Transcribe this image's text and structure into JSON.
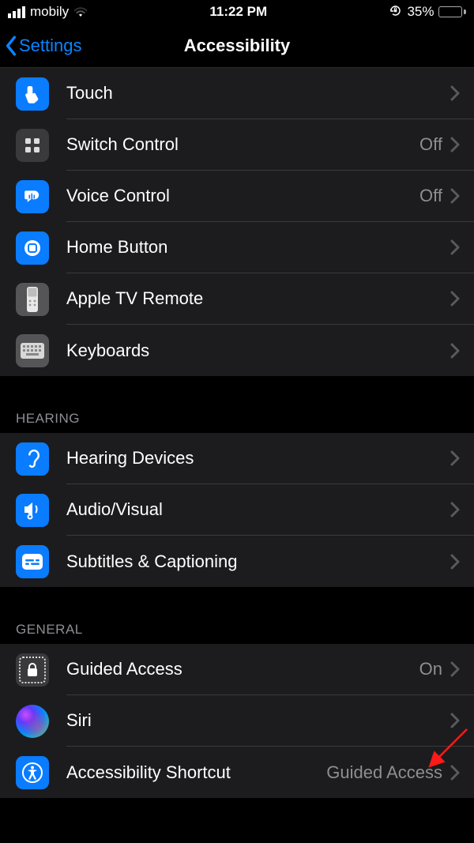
{
  "status": {
    "carrier": "mobily",
    "time": "11:22 PM",
    "battery_pct": "35%"
  },
  "nav": {
    "back": "Settings",
    "title": "Accessibility"
  },
  "sections": {
    "top": {
      "touch": "Touch",
      "switch_control": "Switch Control",
      "switch_control_val": "Off",
      "voice_control": "Voice Control",
      "voice_control_val": "Off",
      "home_button": "Home Button",
      "apple_tv_remote": "Apple TV Remote",
      "keyboards": "Keyboards"
    },
    "hearing_header": "HEARING",
    "hearing": {
      "hearing_devices": "Hearing Devices",
      "audio_visual": "Audio/Visual",
      "subtitles": "Subtitles & Captioning"
    },
    "general_header": "GENERAL",
    "general": {
      "guided_access": "Guided Access",
      "guided_access_val": "On",
      "siri": "Siri",
      "a11y_shortcut": "Accessibility Shortcut",
      "a11y_shortcut_val": "Guided Access"
    }
  },
  "colors": {
    "accent_blue": "#0a84ff",
    "row_bg": "#1c1c1e",
    "secondary_text": "#8e8e93",
    "battery_yellow": "#ffd60a"
  }
}
